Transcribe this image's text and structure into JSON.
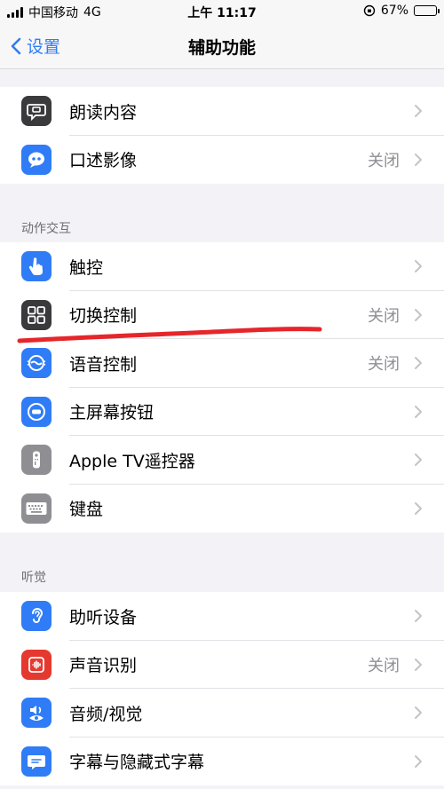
{
  "status_bar": {
    "carrier": "中国移动",
    "network": "4G",
    "time": "上午 11:17",
    "battery": "67%",
    "battery_level": 0.67
  },
  "nav": {
    "back_label": "设置",
    "title": "辅助功能"
  },
  "group_top": {
    "items": [
      {
        "label": "朗读内容",
        "value": ""
      },
      {
        "label": "口述影像",
        "value": "关闭"
      }
    ]
  },
  "section_motor": {
    "header": "动作交互",
    "items": [
      {
        "label": "触控",
        "value": ""
      },
      {
        "label": "切换控制",
        "value": "关闭"
      },
      {
        "label": "语音控制",
        "value": "关闭"
      },
      {
        "label": "主屏幕按钮",
        "value": ""
      },
      {
        "label": "Apple TV遥控器",
        "value": ""
      },
      {
        "label": "键盘",
        "value": ""
      }
    ]
  },
  "section_hearing": {
    "header": "听觉",
    "items": [
      {
        "label": "助听设备",
        "value": ""
      },
      {
        "label": "声音识别",
        "value": "关闭"
      },
      {
        "label": "音频/视觉",
        "value": ""
      },
      {
        "label": "字幕与隐藏式字幕",
        "value": ""
      }
    ]
  },
  "colors": {
    "accent": "#2f7cf6",
    "annotation": "#e5262b"
  }
}
